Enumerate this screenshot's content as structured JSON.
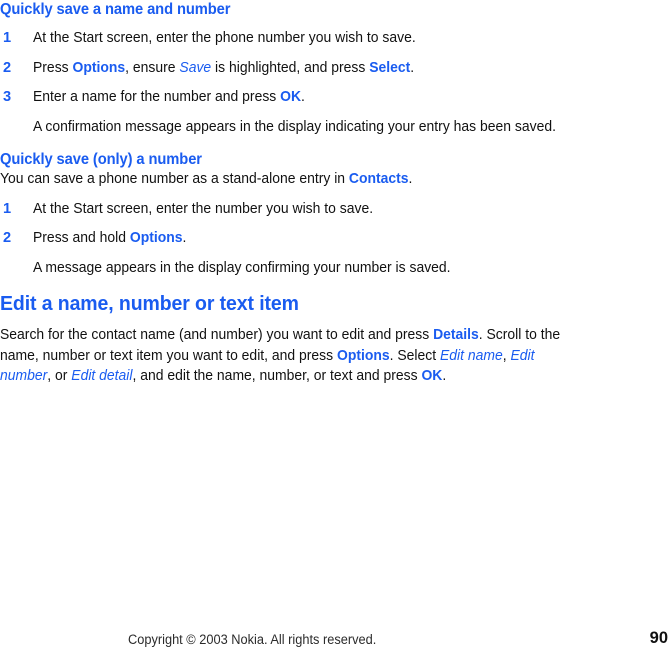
{
  "page": {
    "number": "90",
    "accent_color": "#1a5cf0",
    "text_color": "#111111",
    "background_color": "#ffffff"
  },
  "sections": {
    "quick_save_name_number": {
      "heading": "Quickly save a name and number",
      "steps": [
        {
          "num": "1",
          "parts": [
            {
              "t": "At the Start screen, enter the phone number you wish to save.",
              "style": "plain"
            }
          ]
        },
        {
          "num": "2",
          "parts": [
            {
              "t": "Press ",
              "style": "plain"
            },
            {
              "t": "Options",
              "style": "key"
            },
            {
              "t": ", ensure ",
              "style": "plain"
            },
            {
              "t": "Save",
              "style": "menu"
            },
            {
              "t": " is highlighted, and press ",
              "style": "plain"
            },
            {
              "t": "Select",
              "style": "key"
            },
            {
              "t": ".",
              "style": "plain"
            }
          ]
        },
        {
          "num": "3",
          "parts": [
            {
              "t": "Enter a name for the number and press ",
              "style": "plain"
            },
            {
              "t": "OK",
              "style": "key"
            },
            {
              "t": ".",
              "style": "plain"
            }
          ]
        }
      ],
      "note": "A confirmation message appears in the display indicating your entry has been saved."
    },
    "quick_save_only_number": {
      "heading": "Quickly save (only) a number",
      "intro_parts": [
        {
          "t": "You can save a phone number as a stand-alone entry in ",
          "style": "plain"
        },
        {
          "t": "Contacts",
          "style": "key"
        },
        {
          "t": ".",
          "style": "plain"
        }
      ],
      "steps": [
        {
          "num": "1",
          "parts": [
            {
              "t": "At the Start screen, enter the number you wish to save.",
              "style": "plain"
            }
          ]
        },
        {
          "num": "2",
          "parts": [
            {
              "t": "Press and hold ",
              "style": "plain"
            },
            {
              "t": "Options",
              "style": "key"
            },
            {
              "t": ".",
              "style": "plain"
            }
          ]
        }
      ],
      "note": "A message appears in the display confirming your number is saved."
    },
    "edit_item": {
      "heading": "Edit a name, number or text item",
      "body_parts": [
        {
          "t": "Search for the contact name (and number) you want to edit and press ",
          "style": "plain"
        },
        {
          "t": "Details",
          "style": "key"
        },
        {
          "t": ". Scroll to the name, number or text item you want to edit, and press ",
          "style": "plain"
        },
        {
          "t": "Options",
          "style": "key"
        },
        {
          "t": ". Select ",
          "style": "plain"
        },
        {
          "t": "Edit name",
          "style": "menu"
        },
        {
          "t": ", ",
          "style": "plain"
        },
        {
          "t": "Edit number",
          "style": "menu"
        },
        {
          "t": ", or ",
          "style": "plain"
        },
        {
          "t": "Edit detail",
          "style": "menu"
        },
        {
          "t": ", and edit the name, number, or text and press ",
          "style": "plain"
        },
        {
          "t": "OK",
          "style": "key"
        },
        {
          "t": ".",
          "style": "plain"
        }
      ]
    }
  },
  "footer": {
    "copyright": "Copyright © 2003 Nokia. All rights reserved.",
    "page_number": "90"
  }
}
